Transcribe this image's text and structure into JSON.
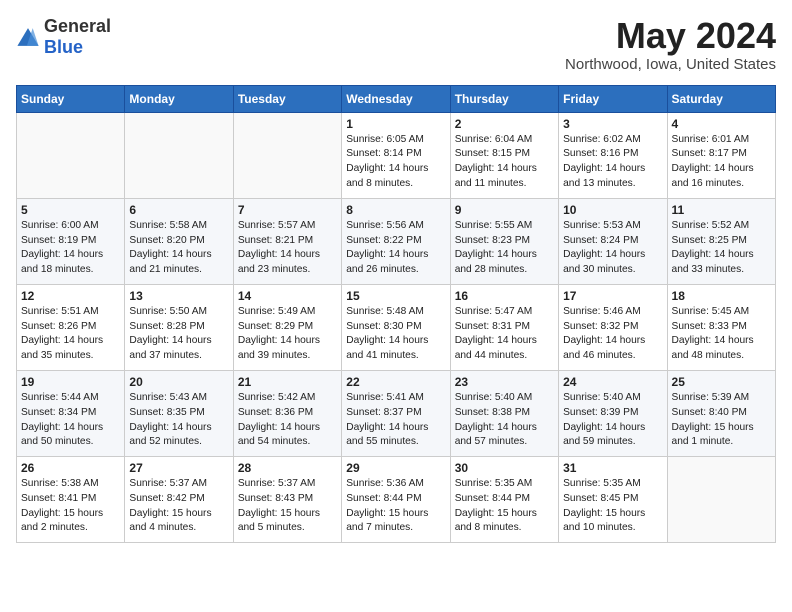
{
  "logo": {
    "general": "General",
    "blue": "Blue"
  },
  "title": "May 2024",
  "location": "Northwood, Iowa, United States",
  "days_header": [
    "Sunday",
    "Monday",
    "Tuesday",
    "Wednesday",
    "Thursday",
    "Friday",
    "Saturday"
  ],
  "weeks": [
    [
      {
        "day": "",
        "info": ""
      },
      {
        "day": "",
        "info": ""
      },
      {
        "day": "",
        "info": ""
      },
      {
        "day": "1",
        "info": "Sunrise: 6:05 AM\nSunset: 8:14 PM\nDaylight: 14 hours\nand 8 minutes."
      },
      {
        "day": "2",
        "info": "Sunrise: 6:04 AM\nSunset: 8:15 PM\nDaylight: 14 hours\nand 11 minutes."
      },
      {
        "day": "3",
        "info": "Sunrise: 6:02 AM\nSunset: 8:16 PM\nDaylight: 14 hours\nand 13 minutes."
      },
      {
        "day": "4",
        "info": "Sunrise: 6:01 AM\nSunset: 8:17 PM\nDaylight: 14 hours\nand 16 minutes."
      }
    ],
    [
      {
        "day": "5",
        "info": "Sunrise: 6:00 AM\nSunset: 8:19 PM\nDaylight: 14 hours\nand 18 minutes."
      },
      {
        "day": "6",
        "info": "Sunrise: 5:58 AM\nSunset: 8:20 PM\nDaylight: 14 hours\nand 21 minutes."
      },
      {
        "day": "7",
        "info": "Sunrise: 5:57 AM\nSunset: 8:21 PM\nDaylight: 14 hours\nand 23 minutes."
      },
      {
        "day": "8",
        "info": "Sunrise: 5:56 AM\nSunset: 8:22 PM\nDaylight: 14 hours\nand 26 minutes."
      },
      {
        "day": "9",
        "info": "Sunrise: 5:55 AM\nSunset: 8:23 PM\nDaylight: 14 hours\nand 28 minutes."
      },
      {
        "day": "10",
        "info": "Sunrise: 5:53 AM\nSunset: 8:24 PM\nDaylight: 14 hours\nand 30 minutes."
      },
      {
        "day": "11",
        "info": "Sunrise: 5:52 AM\nSunset: 8:25 PM\nDaylight: 14 hours\nand 33 minutes."
      }
    ],
    [
      {
        "day": "12",
        "info": "Sunrise: 5:51 AM\nSunset: 8:26 PM\nDaylight: 14 hours\nand 35 minutes."
      },
      {
        "day": "13",
        "info": "Sunrise: 5:50 AM\nSunset: 8:28 PM\nDaylight: 14 hours\nand 37 minutes."
      },
      {
        "day": "14",
        "info": "Sunrise: 5:49 AM\nSunset: 8:29 PM\nDaylight: 14 hours\nand 39 minutes."
      },
      {
        "day": "15",
        "info": "Sunrise: 5:48 AM\nSunset: 8:30 PM\nDaylight: 14 hours\nand 41 minutes."
      },
      {
        "day": "16",
        "info": "Sunrise: 5:47 AM\nSunset: 8:31 PM\nDaylight: 14 hours\nand 44 minutes."
      },
      {
        "day": "17",
        "info": "Sunrise: 5:46 AM\nSunset: 8:32 PM\nDaylight: 14 hours\nand 46 minutes."
      },
      {
        "day": "18",
        "info": "Sunrise: 5:45 AM\nSunset: 8:33 PM\nDaylight: 14 hours\nand 48 minutes."
      }
    ],
    [
      {
        "day": "19",
        "info": "Sunrise: 5:44 AM\nSunset: 8:34 PM\nDaylight: 14 hours\nand 50 minutes."
      },
      {
        "day": "20",
        "info": "Sunrise: 5:43 AM\nSunset: 8:35 PM\nDaylight: 14 hours\nand 52 minutes."
      },
      {
        "day": "21",
        "info": "Sunrise: 5:42 AM\nSunset: 8:36 PM\nDaylight: 14 hours\nand 54 minutes."
      },
      {
        "day": "22",
        "info": "Sunrise: 5:41 AM\nSunset: 8:37 PM\nDaylight: 14 hours\nand 55 minutes."
      },
      {
        "day": "23",
        "info": "Sunrise: 5:40 AM\nSunset: 8:38 PM\nDaylight: 14 hours\nand 57 minutes."
      },
      {
        "day": "24",
        "info": "Sunrise: 5:40 AM\nSunset: 8:39 PM\nDaylight: 14 hours\nand 59 minutes."
      },
      {
        "day": "25",
        "info": "Sunrise: 5:39 AM\nSunset: 8:40 PM\nDaylight: 15 hours\nand 1 minute."
      }
    ],
    [
      {
        "day": "26",
        "info": "Sunrise: 5:38 AM\nSunset: 8:41 PM\nDaylight: 15 hours\nand 2 minutes."
      },
      {
        "day": "27",
        "info": "Sunrise: 5:37 AM\nSunset: 8:42 PM\nDaylight: 15 hours\nand 4 minutes."
      },
      {
        "day": "28",
        "info": "Sunrise: 5:37 AM\nSunset: 8:43 PM\nDaylight: 15 hours\nand 5 minutes."
      },
      {
        "day": "29",
        "info": "Sunrise: 5:36 AM\nSunset: 8:44 PM\nDaylight: 15 hours\nand 7 minutes."
      },
      {
        "day": "30",
        "info": "Sunrise: 5:35 AM\nSunset: 8:44 PM\nDaylight: 15 hours\nand 8 minutes."
      },
      {
        "day": "31",
        "info": "Sunrise: 5:35 AM\nSunset: 8:45 PM\nDaylight: 15 hours\nand 10 minutes."
      },
      {
        "day": "",
        "info": ""
      }
    ]
  ]
}
